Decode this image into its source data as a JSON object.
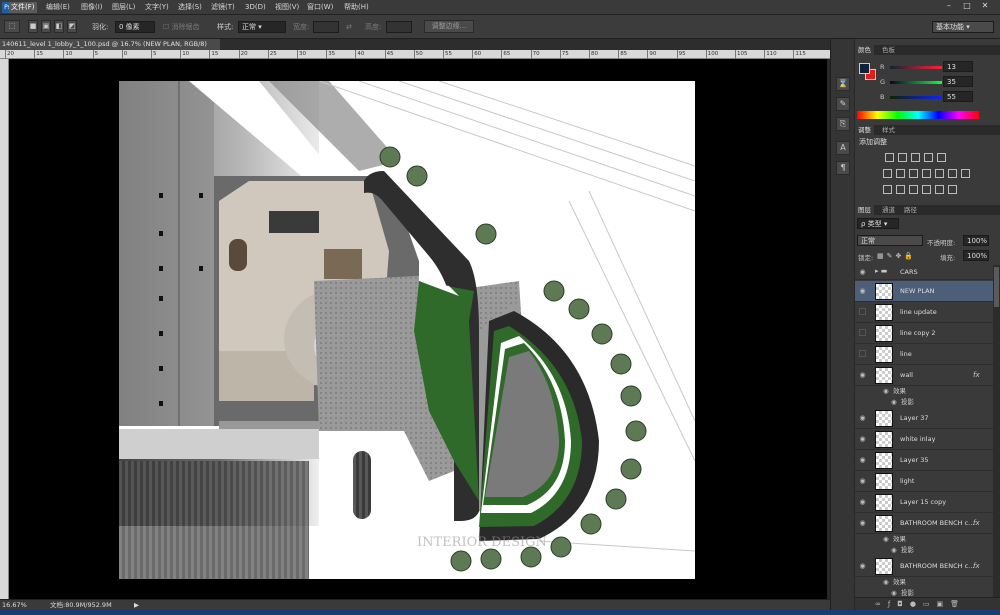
{
  "menubar": {
    "logo": "Ps",
    "items": [
      "文件(F)",
      "编辑(E)",
      "图像(I)",
      "图层(L)",
      "文字(Y)",
      "选择(S)",
      "滤镜(T)",
      "3D(D)",
      "视图(V)",
      "窗口(W)",
      "帮助(H)"
    ],
    "active_index": 0
  },
  "options": {
    "feather_label": "羽化:",
    "feather_value": "0 像素",
    "antialias_label": "消除锯齿",
    "style_label": "样式:",
    "style_value": "正常",
    "width_label": "宽度:",
    "height_label": "高度:",
    "refine_button": "调整边缘...",
    "workspace": "基本功能"
  },
  "document": {
    "tab_title": "140611_level 1_lobby_1_100.psd @ 16.7% (NEW PLAN, RGB/8)",
    "watermark_line1": "INTERIOR DESIGN",
    "ruler_top": [
      "20",
      "15",
      "10",
      "5",
      "0",
      "5",
      "10",
      "15",
      "20",
      "25",
      "30",
      "35",
      "40",
      "45",
      "50",
      "55",
      "60",
      "65",
      "70",
      "75",
      "80",
      "85",
      "90",
      "95",
      "100",
      "105",
      "110",
      "115"
    ]
  },
  "status": {
    "zoom": "16.67%",
    "doc_size": "文档:80.9M/952.9M"
  },
  "color_panel": {
    "tabs": [
      "颜色",
      "色板"
    ],
    "r_label": "R",
    "r_value": "13",
    "g_label": "G",
    "g_value": "35",
    "b_label": "B",
    "b_value": "55",
    "fg_color": "#0d2337",
    "bg_color": "#e21b1b"
  },
  "adjust_panel": {
    "tabs": [
      "调整",
      "样式"
    ],
    "title": "添加调整"
  },
  "layers_panel": {
    "tabs": [
      "图层",
      "通道",
      "路径"
    ],
    "filter_label": "ρ 类型",
    "blend_mode": "正常",
    "opacity_label": "不透明度:",
    "opacity_value": "100%",
    "lock_label": "锁定:",
    "fill_label": "填充:",
    "fill_value": "100%",
    "effect_label": "效果",
    "shadow_label": "投影",
    "fx": "fx",
    "group_name": "CARS",
    "layers": [
      {
        "name": "NEW PLAN"
      },
      {
        "name": "line update"
      },
      {
        "name": "line copy 2"
      },
      {
        "name": "line"
      },
      {
        "name": "wall"
      },
      {
        "name": "Layer 37"
      },
      {
        "name": "white inlay"
      },
      {
        "name": "Layer 35"
      },
      {
        "name": "light"
      },
      {
        "name": "Layer 15 copy"
      },
      {
        "name": "BATHROOM BENCH c..."
      },
      {
        "name": "BATHROOM BENCH c..."
      }
    ]
  }
}
